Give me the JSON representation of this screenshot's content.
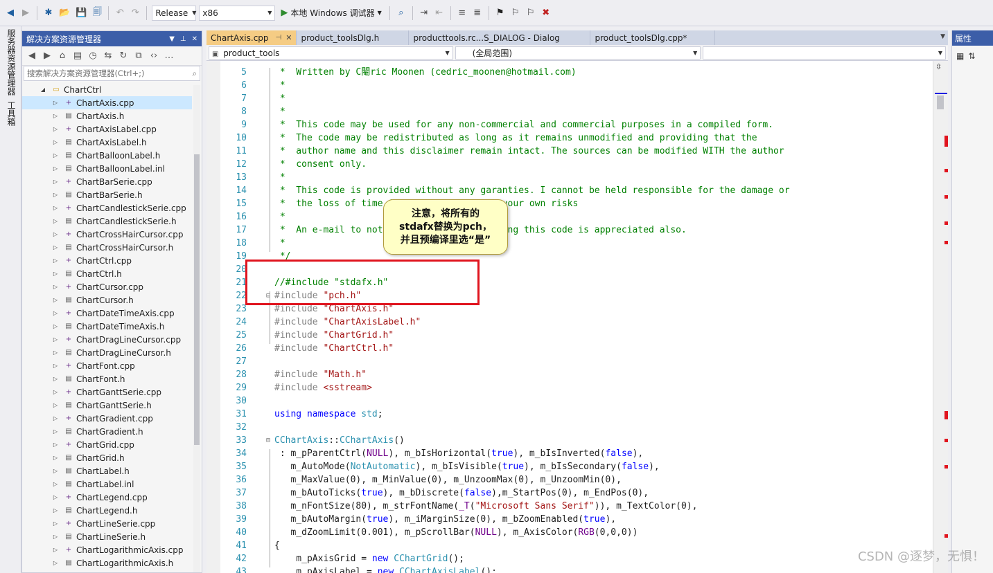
{
  "toolbar": {
    "config": "Release",
    "platform": "x86",
    "run_label": "本地 Windows 调试器"
  },
  "left_strip": {
    "tabs": [
      "服务器资源管理器",
      "工具箱"
    ]
  },
  "solution_explorer": {
    "title": "解决方案资源管理器",
    "search_placeholder": "搜索解决方案资源管理器(Ctrl+;)",
    "folder": "ChartCtrl",
    "files": [
      "ChartAxis.cpp",
      "ChartAxis.h",
      "ChartAxisLabel.cpp",
      "ChartAxisLabel.h",
      "ChartBalloonLabel.h",
      "ChartBalloonLabel.inl",
      "ChartBarSerie.cpp",
      "ChartBarSerie.h",
      "ChartCandlestickSerie.cpp",
      "ChartCandlestickSerie.h",
      "ChartCrossHairCursor.cpp",
      "ChartCrossHairCursor.h",
      "ChartCtrl.cpp",
      "ChartCtrl.h",
      "ChartCursor.cpp",
      "ChartCursor.h",
      "ChartDateTimeAxis.cpp",
      "ChartDateTimeAxis.h",
      "ChartDragLineCursor.cpp",
      "ChartDragLineCursor.h",
      "ChartFont.cpp",
      "ChartFont.h",
      "ChartGanttSerie.cpp",
      "ChartGanttSerie.h",
      "ChartGradient.cpp",
      "ChartGradient.h",
      "ChartGrid.cpp",
      "ChartGrid.h",
      "ChartLabel.h",
      "ChartLabel.inl",
      "ChartLegend.cpp",
      "ChartLegend.h",
      "ChartLineSerie.cpp",
      "ChartLineSerie.h",
      "ChartLogarithmicAxis.cpp",
      "ChartLogarithmicAxis.h"
    ]
  },
  "doc_tabs": [
    {
      "label": "ChartAxis.cpp"
    },
    {
      "label": "product_toolsDlg.h"
    },
    {
      "label": "producttools.rc...S_DIALOG - Dialog"
    },
    {
      "label": "product_toolsDlg.cpp*"
    }
  ],
  "nav": {
    "project": "product_tools",
    "scope": "(全局范围)",
    "member": ""
  },
  "code_lines": [
    {
      "n": "5",
      "t": " *  Written by C閹ric Moonen (cedric_moonen@hotmail.com)"
    },
    {
      "n": "6",
      "t": " *"
    },
    {
      "n": "7",
      "t": " *"
    },
    {
      "n": "8",
      "t": " *"
    },
    {
      "n": "9",
      "t": " *  This code may be used for any non-commercial and commercial purposes in a compiled form."
    },
    {
      "n": "10",
      "t": " *  The code may be redistributed as long as it remains unmodified and providing that the"
    },
    {
      "n": "11",
      "t": " *  author name and this disclaimer remain intact. The sources can be modified WITH the author"
    },
    {
      "n": "12",
      "t": " *  consent only."
    },
    {
      "n": "13",
      "t": " *"
    },
    {
      "n": "14",
      "t": " *  This code is provided without any garanties. I cannot be held responsible for the damage or"
    },
    {
      "n": "15",
      "t": " *  the loss of time it causes. Use it at your own risks"
    },
    {
      "n": "16",
      "t": " *"
    },
    {
      "n": "17",
      "t": " *  An e-mail to notify me that you are using this code is appreciated also."
    },
    {
      "n": "18",
      "t": " *"
    },
    {
      "n": "19",
      "t": " */"
    },
    {
      "n": "20",
      "t": ""
    },
    {
      "n": "21",
      "t": "//#include \"stdafx.h\""
    },
    {
      "n": "22",
      "t": "#include \"pch.h\""
    },
    {
      "n": "23",
      "t": "#include \"ChartAxis.h\""
    },
    {
      "n": "24",
      "t": "#include \"ChartAxisLabel.h\""
    },
    {
      "n": "25",
      "t": "#include \"ChartGrid.h\""
    },
    {
      "n": "26",
      "t": "#include \"ChartCtrl.h\""
    },
    {
      "n": "27",
      "t": ""
    },
    {
      "n": "28",
      "t": "#include \"Math.h\""
    },
    {
      "n": "29",
      "t": "#include <sstream>"
    },
    {
      "n": "30",
      "t": ""
    },
    {
      "n": "31",
      "t": "using namespace std;"
    },
    {
      "n": "32",
      "t": ""
    },
    {
      "n": "33",
      "t": "CChartAxis::CChartAxis()"
    },
    {
      "n": "34",
      "t": " : m_pParentCtrl(NULL), m_bIsHorizontal(true), m_bIsInverted(false),"
    },
    {
      "n": "35",
      "t": "   m_AutoMode(NotAutomatic), m_bIsVisible(true), m_bIsSecondary(false),"
    },
    {
      "n": "36",
      "t": "   m_MaxValue(0), m_MinValue(0), m_UnzoomMax(0), m_UnzoomMin(0),"
    },
    {
      "n": "37",
      "t": "   m_bAutoTicks(true), m_bDiscrete(false),m_StartPos(0), m_EndPos(0),"
    },
    {
      "n": "38",
      "t": "   m_nFontSize(80), m_strFontName(_T(\"Microsoft Sans Serif\")), m_TextColor(0),"
    },
    {
      "n": "39",
      "t": "   m_bAutoMargin(true), m_iMarginSize(0), m_bZoomEnabled(true),"
    },
    {
      "n": "40",
      "t": "   m_dZoomLimit(0.001), m_pScrollBar(NULL), m_AxisColor(RGB(0,0,0))"
    },
    {
      "n": "41",
      "t": "{"
    },
    {
      "n": "42",
      "t": "    m_pAxisGrid = new CChartGrid();"
    },
    {
      "n": "43",
      "t": "    m_pAxisLabel = new CChartAxisLabel();"
    }
  ],
  "callout": {
    "line1": "注意，将所有的",
    "line2": "stdafx替换为pch，",
    "line3": "并且预编译里选“是”"
  },
  "properties": {
    "title": "属性"
  },
  "watermark": "CSDN @逐梦，无惧！",
  "colors": {
    "accent": "#3c5ea8",
    "active_tab": "#f5cc84",
    "highlight_box": "#e0141e"
  }
}
